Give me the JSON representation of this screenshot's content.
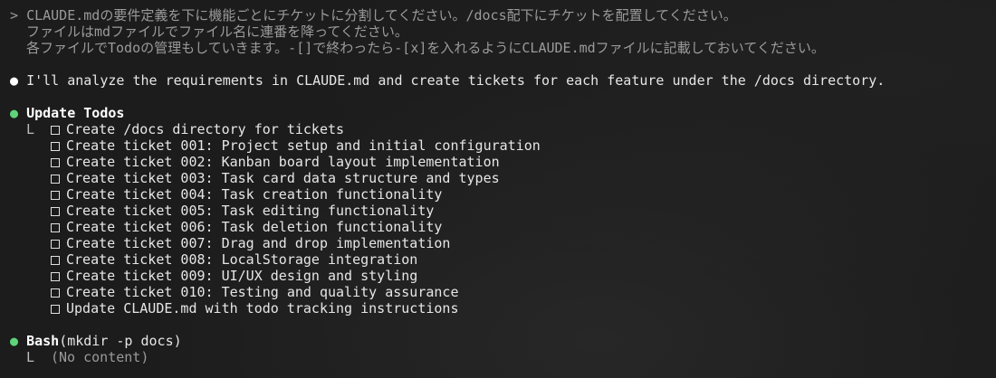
{
  "prompt": {
    "symbol": ">",
    "lines": [
      "CLAUDE.mdの要件定義を下に機能ごとにチケットに分割してください。/docs配下にチケットを配置してください。",
      "ファイルはmdファイルでファイル名に連番を降ってください。",
      "各ファイルでTodoの管理もしていきます。-[]で終わったら-[x]を入れるようにCLAUDE.mdファイルに記載しておいてください。"
    ]
  },
  "assistant_message": {
    "bullet": "●",
    "text": "I'll analyze the requirements in CLAUDE.md and create tickets for each feature under the /docs directory."
  },
  "update_todos": {
    "bullet": "●",
    "title": "Update Todos",
    "corner": "L",
    "items": [
      "Create /docs directory for tickets",
      "Create ticket 001: Project setup and initial configuration",
      "Create ticket 002: Kanban board layout implementation",
      "Create ticket 003: Task card data structure and types",
      "Create ticket 004: Task creation functionality",
      "Create ticket 005: Task editing functionality",
      "Create ticket 006: Task deletion functionality",
      "Create ticket 007: Drag and drop implementation",
      "Create ticket 008: LocalStorage integration",
      "Create ticket 009: UI/UX design and styling",
      "Create ticket 010: Testing and quality assurance",
      "Update CLAUDE.md with todo tracking instructions"
    ]
  },
  "bash": {
    "bullet": "●",
    "tool": "Bash",
    "args": "(mkdir -p docs)",
    "corner": "L",
    "output": "(No content)"
  },
  "colors": {
    "background": "#1c1c1c",
    "text": "#e6e6e6",
    "dim": "#9a9a9a",
    "green_bullet": "#5fd37a"
  }
}
